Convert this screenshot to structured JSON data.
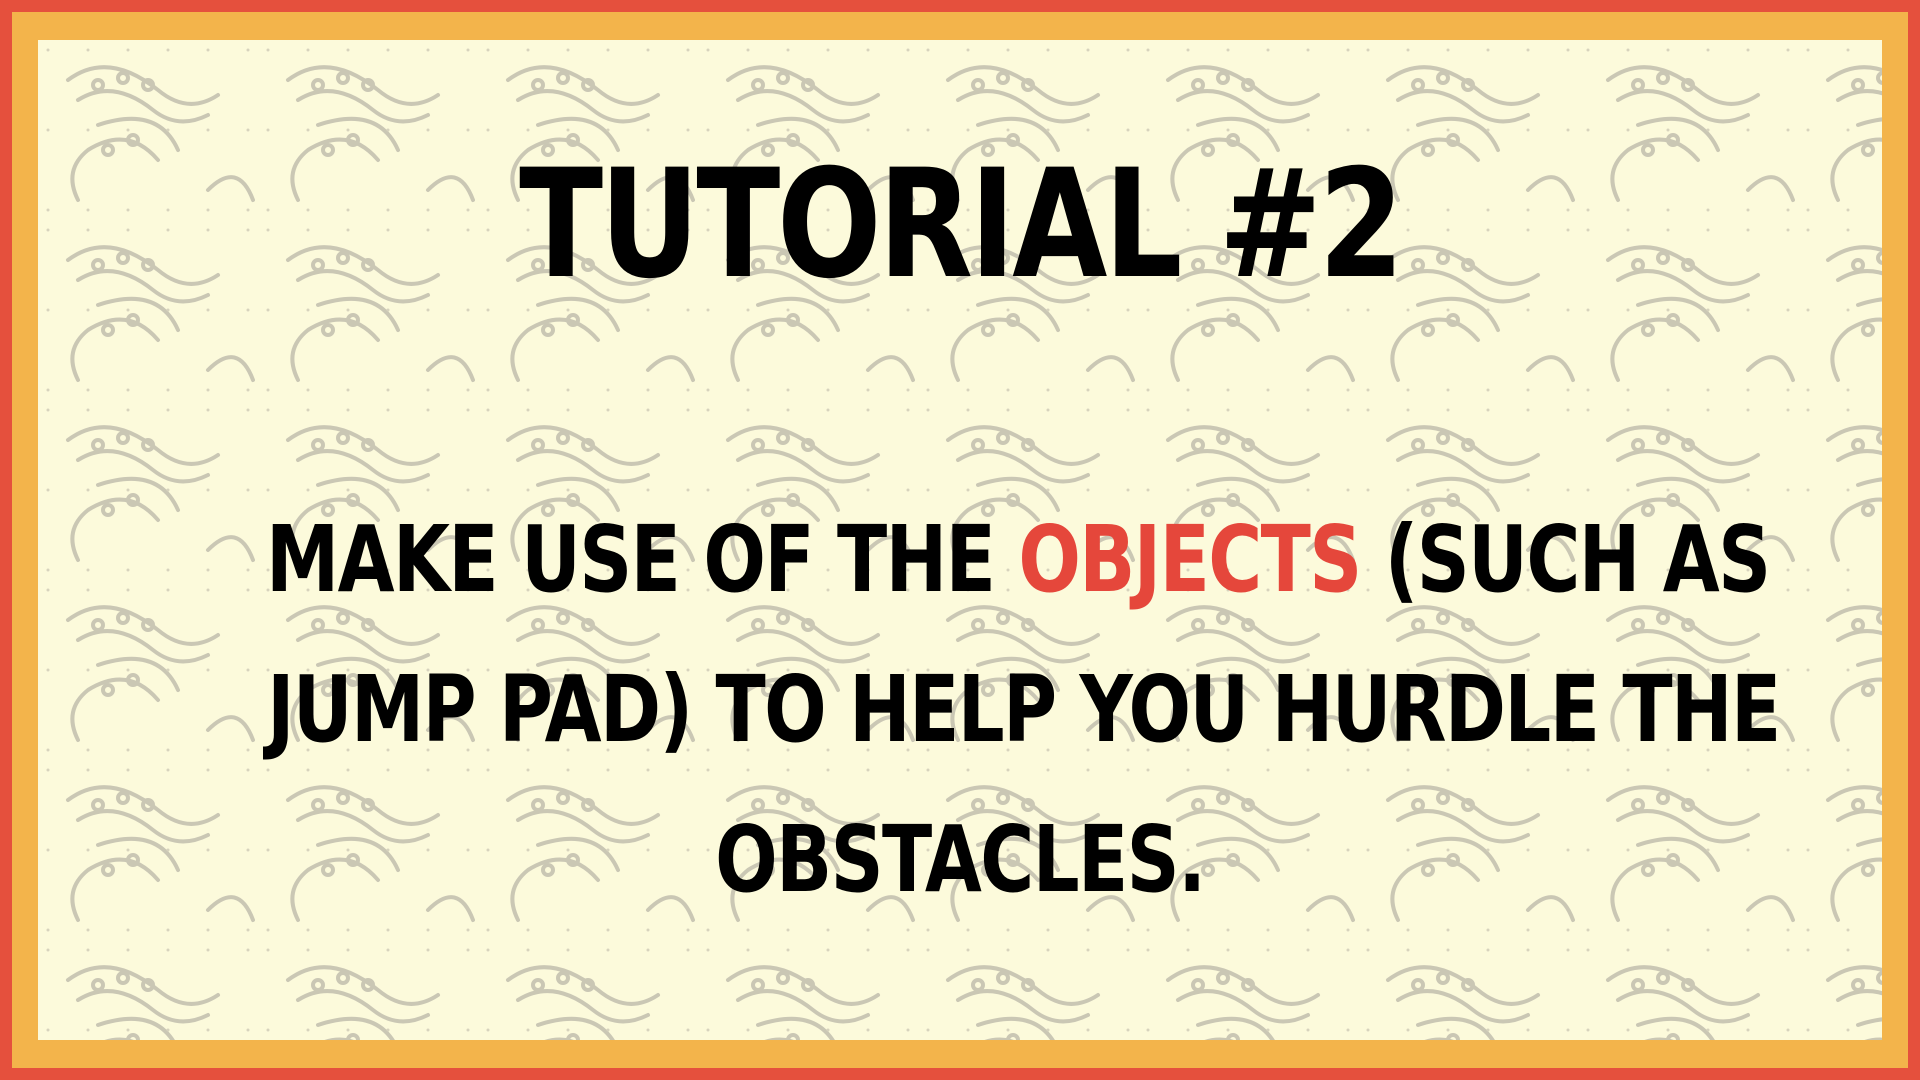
{
  "screen": {
    "title": "TUTORIAL #2",
    "message_lines": [
      {
        "before": "MAKE USE OF THE ",
        "highlight": "OBJECTS",
        "after": " (SUCH AS"
      },
      {
        "text": "JUMP PAD) TO HELP YOU HURDLE THE"
      },
      {
        "text": "OBSTACLES."
      }
    ]
  },
  "colors": {
    "outer_border": "#E5503D",
    "inner_border": "#F3B44B",
    "background": "#FCFADB",
    "pattern_stroke": "#B9B6A7",
    "text": "#000000",
    "highlight": "#E5473B"
  },
  "decor": {
    "background_pattern": "dotted-swirl-pattern"
  }
}
